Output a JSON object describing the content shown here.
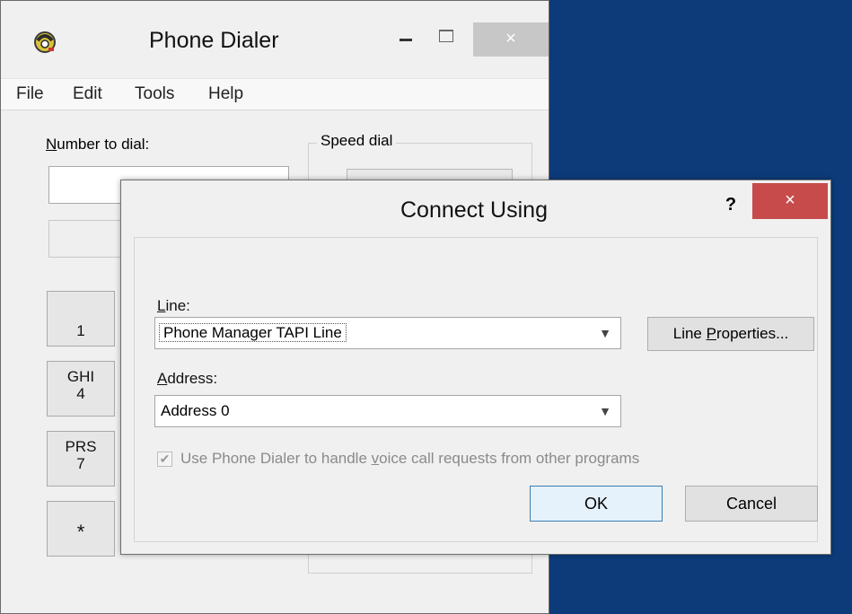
{
  "main_window": {
    "title": "Phone Dialer",
    "close_glyph": "×",
    "menu": [
      "File",
      "Edit",
      "Tools",
      "Help"
    ],
    "number_label_prefix": "N",
    "number_label_rest": "umber to dial:",
    "speed_dial_label": "Speed dial",
    "keypad": [
      {
        "letters": "",
        "digit": "1"
      },
      {
        "letters": "GHI",
        "digit": "4"
      },
      {
        "letters": "PRS",
        "digit": "7"
      },
      {
        "letters": "",
        "digit": "*"
      }
    ]
  },
  "dialog": {
    "title": "Connect Using",
    "help_glyph": "?",
    "close_glyph": "×",
    "line_label_prefix": "L",
    "line_label_rest": "ine:",
    "line_value": "Phone Manager TAPI Line",
    "line_properties_a": "Line ",
    "line_properties_u": "P",
    "line_properties_b": "roperties...",
    "address_label_prefix": "A",
    "address_label_rest": "ddress:",
    "address_value": "Address 0",
    "checkbox_checked": true,
    "checkbox_label_a": "Use Phone Dialer to handle ",
    "checkbox_label_u": "v",
    "checkbox_label_b": "oice call requests from other programs",
    "ok_label": "OK",
    "cancel_label": "Cancel"
  },
  "icons": {
    "app": "phone-dialer-icon",
    "chevron": "chevron-down-icon",
    "check": "checkmark-icon"
  },
  "colors": {
    "desktop": "#0d3b7a",
    "close_red": "#c74b4b"
  }
}
